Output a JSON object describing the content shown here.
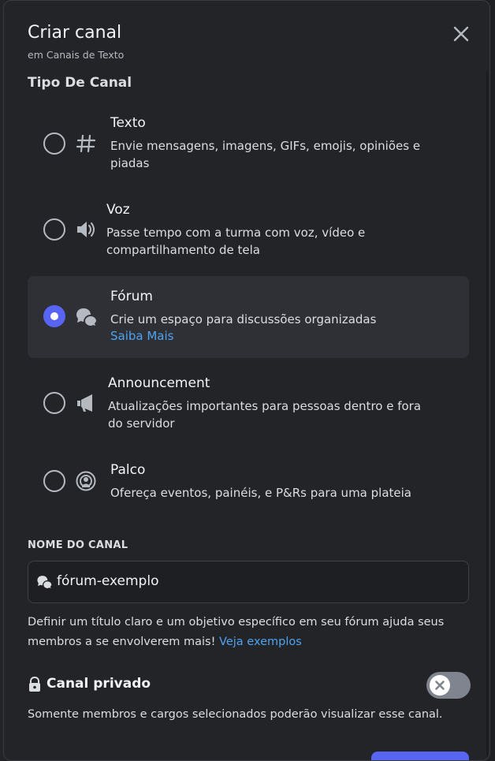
{
  "modal": {
    "title": "Criar canal",
    "subtitle": "em Canais de Texto",
    "section_label": "Tipo De Canal"
  },
  "channel_types": [
    {
      "key": "text",
      "title": "Texto",
      "description": "Envie mensagens, imagens, GIFs, emojis, opiniões e piadas",
      "icon": "hash-icon",
      "selected": false
    },
    {
      "key": "voice",
      "title": "Voz",
      "description": "Passe tempo com a turma com voz, vídeo e compartilhamento de tela",
      "icon": "speaker-icon",
      "selected": false
    },
    {
      "key": "forum",
      "title": "Fórum",
      "description": "Crie um espaço para discussões organizadas",
      "link": "Saiba Mais",
      "icon": "forum-icon",
      "selected": true
    },
    {
      "key": "announcement",
      "title": "Announcement",
      "description": "Atualizações importantes para pessoas dentro e fora do servidor",
      "icon": "megaphone-icon",
      "selected": false
    },
    {
      "key": "stage",
      "title": "Palco",
      "description": "Ofereça eventos, painéis, e P&Rs para uma plateia",
      "icon": "stage-icon",
      "selected": false
    }
  ],
  "channel_name": {
    "label": "NOME DO CANAL",
    "value": "fórum-exemplo",
    "helper_text": "Definir um título claro e um objetivo específico em seu fórum ajuda seus membros a se envolverem mais!",
    "helper_link": "Veja exemplos"
  },
  "private": {
    "label": "Canal privado",
    "enabled": false,
    "description": "Somente membros e cargos selecionados poderão visualizar esse canal."
  },
  "colors": {
    "accent": "#5865f2",
    "link": "#4ea3f0",
    "modal_bg": "#232428",
    "selected_bg": "#2e3035"
  }
}
